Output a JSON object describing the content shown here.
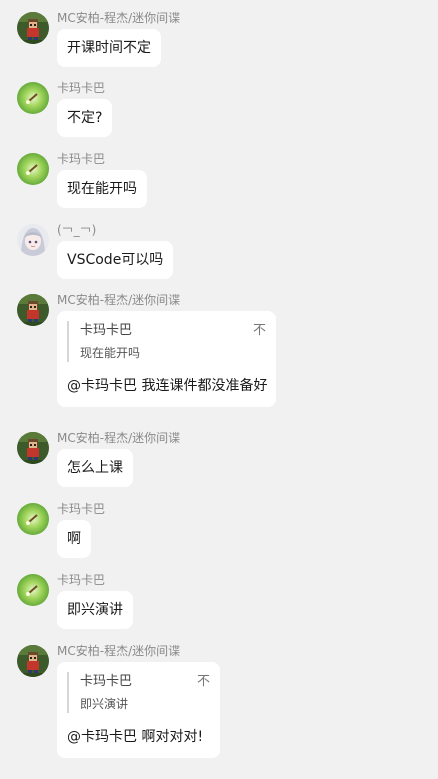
{
  "messages": [
    {
      "sender": "MC安柏-程杰/迷你间谍",
      "avatar": "pixel-avatar-icon",
      "text": "开课时间不定"
    },
    {
      "sender": "卡玛卡巴",
      "avatar": "green-avatar-icon",
      "text": "不定?"
    },
    {
      "sender": "卡玛卡巴",
      "avatar": "green-avatar-icon",
      "text": "现在能开吗"
    },
    {
      "sender": "(￢_￢)",
      "avatar": "anime-avatar-icon",
      "text": "VSCode可以吗"
    },
    {
      "sender": "MC安柏-程杰/迷你间谍",
      "avatar": "pixel-avatar-icon",
      "quote": {
        "name": "卡玛卡巴",
        "close": "不",
        "text": "现在能开吗"
      },
      "text": "@卡玛卡巴 我连课件都没准备好"
    },
    {
      "sender": "MC安柏-程杰/迷你间谍",
      "avatar": "pixel-avatar-icon",
      "text": "怎么上课"
    },
    {
      "sender": "卡玛卡巴",
      "avatar": "green-avatar-icon",
      "text": "啊"
    },
    {
      "sender": "卡玛卡巴",
      "avatar": "green-avatar-icon",
      "text": "即兴演讲"
    },
    {
      "sender": "MC安柏-程杰/迷你间谍",
      "avatar": "pixel-avatar-icon",
      "quote": {
        "name": "卡玛卡巴",
        "close": "不",
        "text": "即兴演讲"
      },
      "text": "@卡玛卡巴 啊对对对!"
    }
  ]
}
